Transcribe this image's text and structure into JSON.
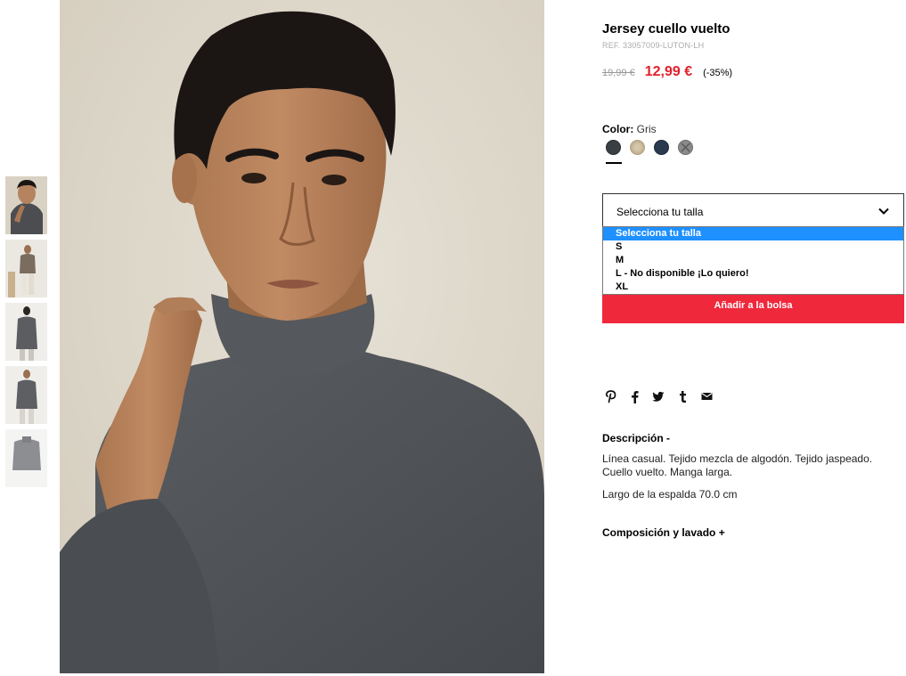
{
  "product": {
    "title": "Jersey cuello vuelto",
    "ref": "REF. 33057009-LUTON-LH",
    "price_old": "19,99 €",
    "price_new": "12,99 €",
    "discount": "(-35%)"
  },
  "color": {
    "label": "Color:",
    "value": "Gris",
    "swatches": [
      {
        "name": "charcoal",
        "color": "#3a3f44"
      },
      {
        "name": "beige",
        "color": "#c8b89a"
      },
      {
        "name": "navy",
        "color": "#2c3a4f"
      },
      {
        "name": "grey",
        "color": "#8a8a8a"
      }
    ]
  },
  "size": {
    "placeholder": "Selecciona tu talla",
    "options": [
      "Selecciona tu talla",
      "S",
      "M",
      "L - No disponible ¡Lo quiero!",
      "XL"
    ]
  },
  "add_button": "Añadir a la bolsa",
  "share_icons": [
    "pinterest-icon",
    "facebook-icon",
    "twitter-icon",
    "tumblr-icon",
    "email-icon"
  ],
  "description": {
    "title": "Descripción -",
    "text": "Línea casual. Tejido mezcla de algodón. Tejido jaspeado. Cuello vuelto. Manga larga.",
    "size_note": "Largo de la espalda 70.0 cm"
  },
  "composition_title": "Composición y lavado +",
  "colors": {
    "accent": "#f0283c",
    "price_red": "#e2202c",
    "highlight": "#1e90ff"
  }
}
